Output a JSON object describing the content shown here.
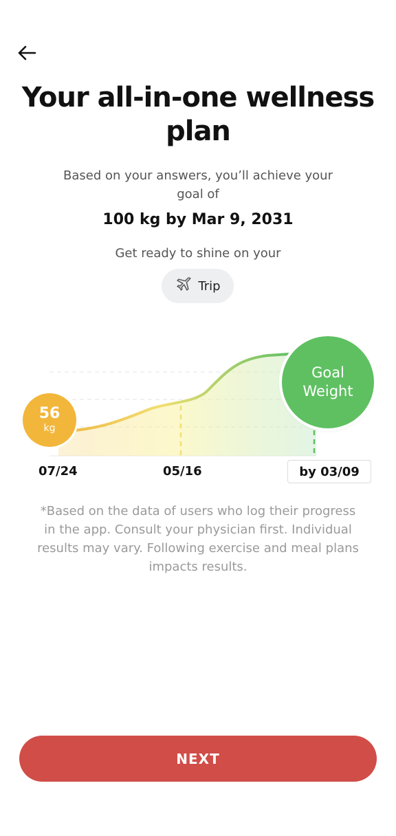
{
  "header": {
    "back_icon": "arrow-left-icon",
    "title": "Your all-in-one wellness plan"
  },
  "summary": {
    "subtitle": "Based on your answers, you’ll achieve your goal of",
    "goal": "100 kg by Mar 9, 2031",
    "ready_text": "Get ready to shine on your",
    "event": {
      "icon": "airplane-icon",
      "label": "Trip"
    }
  },
  "chart_data": {
    "type": "area",
    "start": {
      "value": "56",
      "unit": "kg",
      "date": "07/24"
    },
    "mid": {
      "date": "05/16"
    },
    "end": {
      "label": "Goal Weight",
      "date": "by 03/09"
    },
    "colors": {
      "start": "#f2b63a",
      "mid": "#f3e37a",
      "end": "#5fc062"
    }
  },
  "disclaimer": "*Based on the data of users who log their progress in the app. Consult your physician first. Individual results may vary. Following exercise and meal plans impacts results.",
  "footer": {
    "next_label": "NEXT",
    "button_color": "#d04d48"
  }
}
